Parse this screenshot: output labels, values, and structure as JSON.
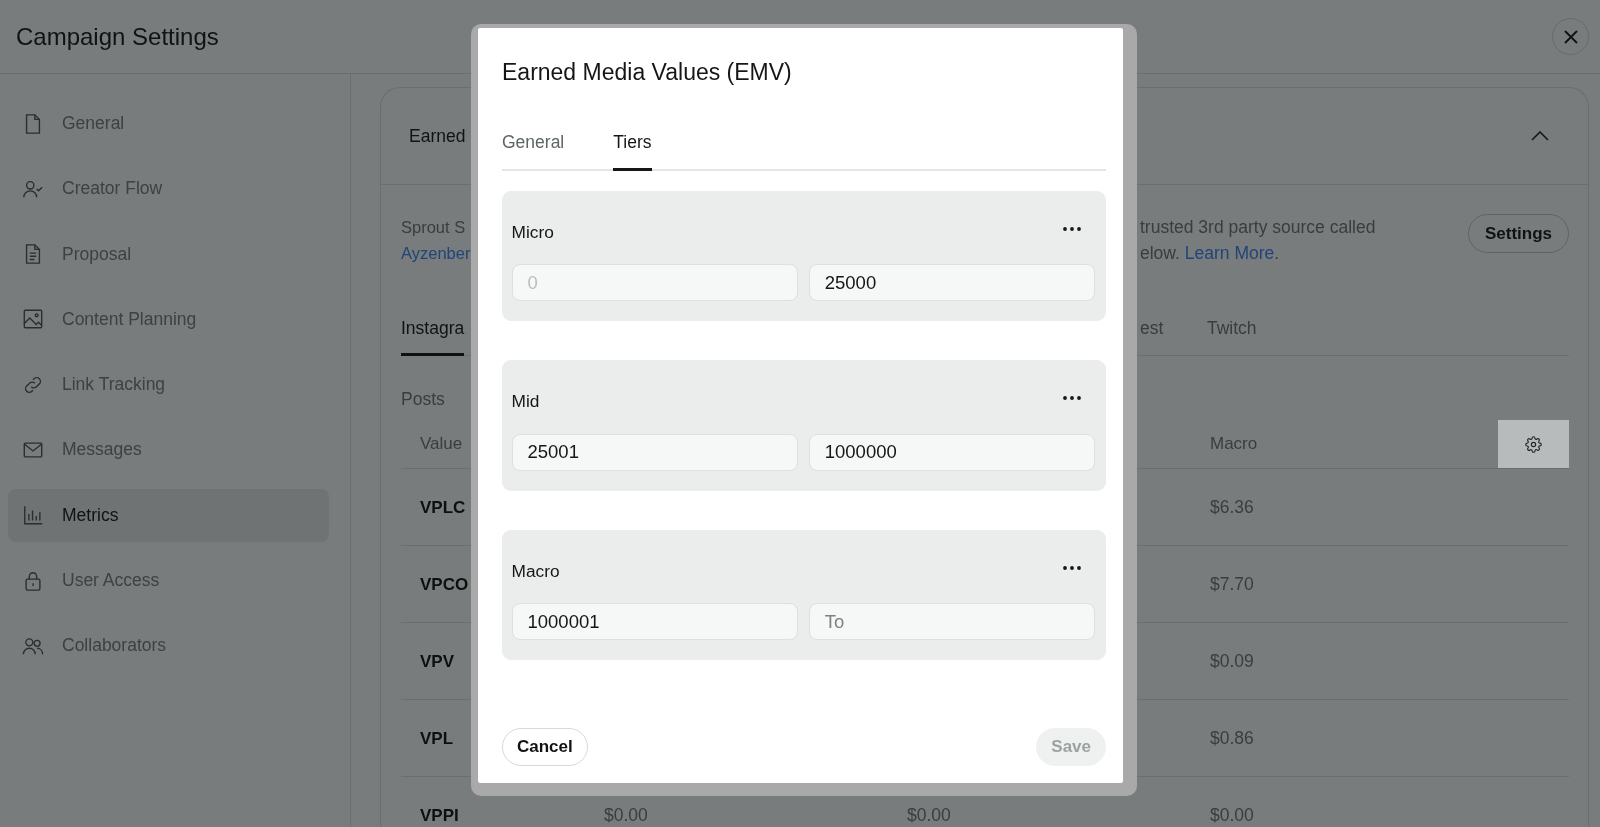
{
  "header": {
    "title": "Campaign Settings"
  },
  "sidebar": {
    "items": [
      {
        "label": "General",
        "selected": false
      },
      {
        "label": "Creator Flow",
        "selected": false
      },
      {
        "label": "Proposal",
        "selected": false
      },
      {
        "label": "Content Planning",
        "selected": false
      },
      {
        "label": "Link Tracking",
        "selected": false
      },
      {
        "label": "Messages",
        "selected": false
      },
      {
        "label": "Metrics",
        "selected": true
      },
      {
        "label": "User Access",
        "selected": false
      },
      {
        "label": "Collaborators",
        "selected": false
      }
    ]
  },
  "card": {
    "title": "Earned",
    "expanded": true,
    "intro_left": {
      "text": "Sprout S",
      "link": "Ayzenber"
    },
    "intro_right": {
      "text": "trusted 3rd party source called",
      "text_2": "elow.",
      "link": "Learn More",
      "end": "."
    },
    "settings_button": "Settings",
    "platform_tabs": [
      {
        "label": "Instagra",
        "selected": true
      },
      {
        "label": "est",
        "selected": false
      },
      {
        "label": "Twitch",
        "selected": false
      }
    ],
    "section_label": "Posts",
    "table": {
      "columns": {
        "value": "Value",
        "macro": "Macro"
      },
      "rows": [
        {
          "value": "VPLC",
          "macro": "$6.36"
        },
        {
          "value": "VPCO",
          "macro": "$7.70"
        },
        {
          "value": "VPV",
          "macro": "$0.09"
        },
        {
          "value": "VPL",
          "macro": "$0.86"
        },
        {
          "value": "VPPI",
          "column_2": "$0.00",
          "column_3": "$0.00",
          "macro": "$0.00"
        }
      ]
    }
  },
  "dialog": {
    "title": "Earned Media Values (EMV)",
    "tabs": [
      {
        "label": "General",
        "selected": false
      },
      {
        "label": "Tiers",
        "selected": true
      }
    ],
    "tiers": [
      {
        "name": "Micro",
        "from": {
          "value": "0",
          "disabled": true
        },
        "to": {
          "value": "25000",
          "disabled": false
        }
      },
      {
        "name": "Mid",
        "from": {
          "value": "25001",
          "disabled": false
        },
        "to": {
          "value": "1000000",
          "disabled": false
        }
      },
      {
        "name": "Macro",
        "from": {
          "value": "1000001",
          "disabled": false
        },
        "to": {
          "placeholder": "To",
          "disabled": false
        }
      }
    ],
    "buttons": [
      {
        "label": "Cancel",
        "disabled": false
      },
      {
        "label": "Save",
        "disabled": true
      }
    ]
  }
}
